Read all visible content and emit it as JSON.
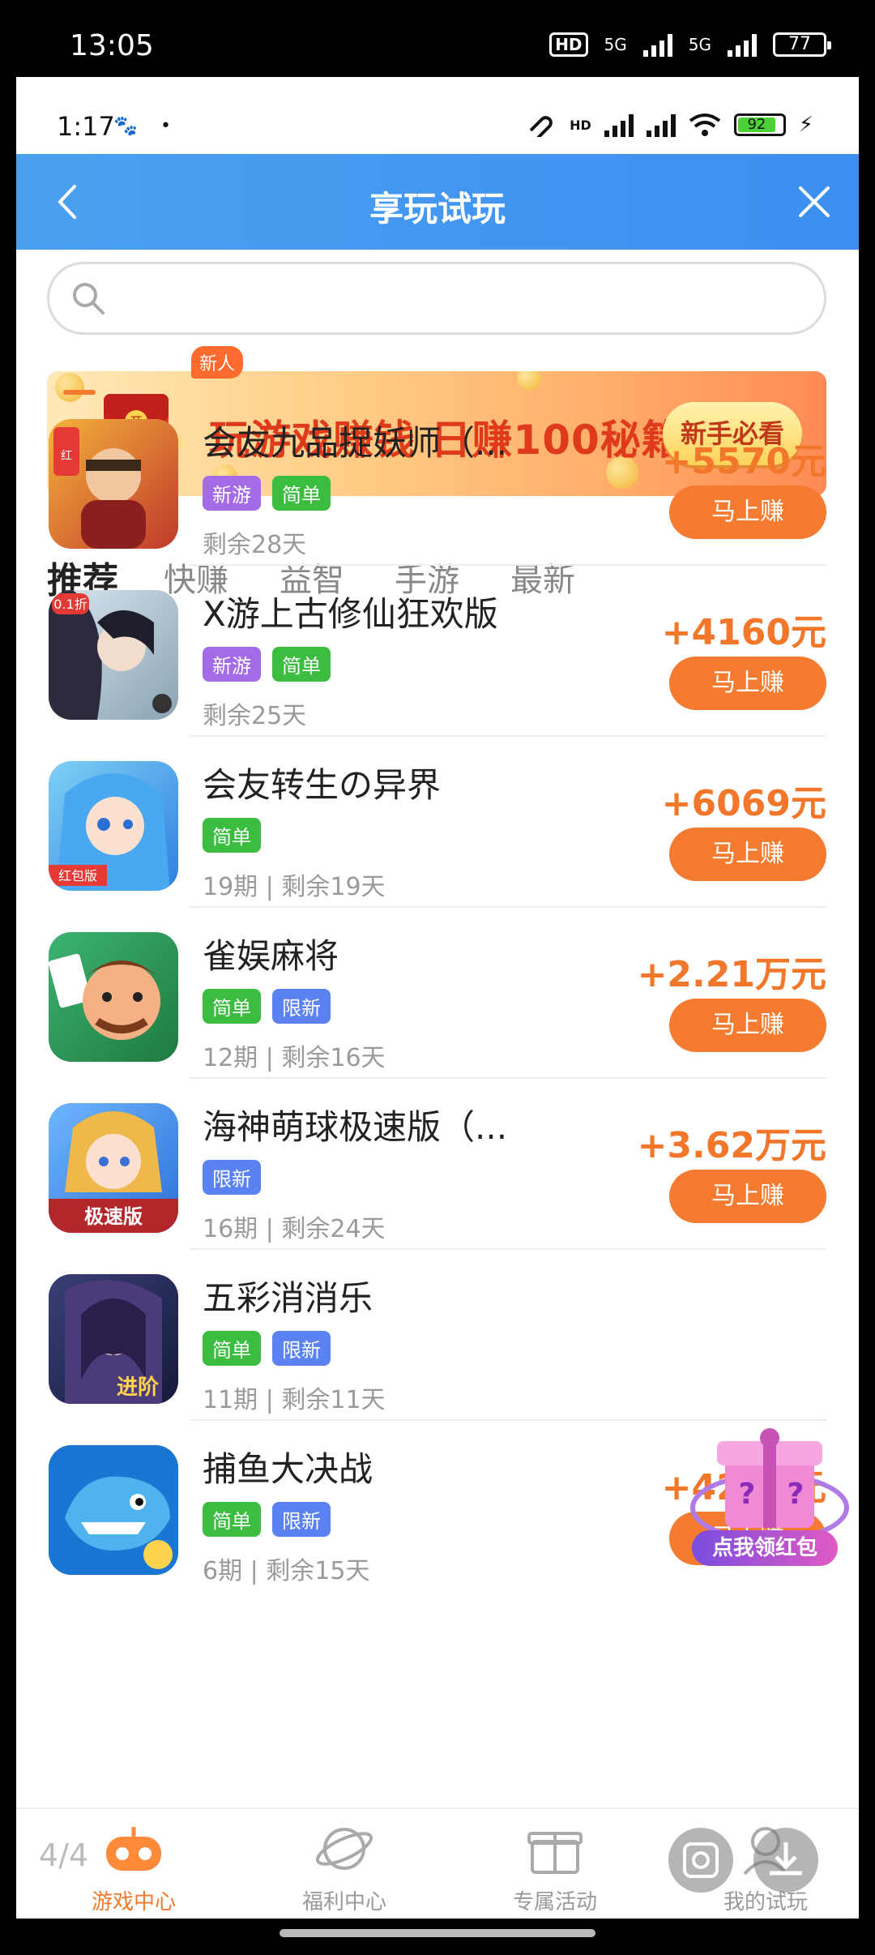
{
  "outer_status": {
    "time": "13:05",
    "hd": "HD",
    "net1": "5G",
    "net2": "5G",
    "battery": "77"
  },
  "inner_status": {
    "time": "1:17",
    "hd": "HD",
    "battery": "92"
  },
  "header": {
    "title": "享玩试玩"
  },
  "search": {
    "placeholder": ""
  },
  "banner": {
    "text": "玩游戏赚钱 日赚100秘籍",
    "cta": "新手必看"
  },
  "tabs": [
    {
      "label": "推荐",
      "active": true
    },
    {
      "label": "快赚",
      "badge": "新人"
    },
    {
      "label": "益智"
    },
    {
      "label": "手游"
    },
    {
      "label": "最新"
    }
  ],
  "games": [
    {
      "name": "会友九品捉妖师（...",
      "tags": [
        "新游",
        "简单"
      ],
      "meta": "剩余28天",
      "reward": "+5570元",
      "button": "马上赚"
    },
    {
      "name": "X游上古修仙狂欢版",
      "tags": [
        "新游",
        "简单"
      ],
      "meta": "剩余25天",
      "reward": "+4160元",
      "button": "马上赚"
    },
    {
      "name": "会友转生の异界",
      "tags": [
        "简单"
      ],
      "meta": "19期 | 剩余19天",
      "reward": "+6069元",
      "button": "马上赚"
    },
    {
      "name": "雀娱麻将",
      "tags": [
        "简单",
        "限新"
      ],
      "meta": "12期 | 剩余16天",
      "reward": "+2.21万元",
      "button": "马上赚"
    },
    {
      "name": "海神萌球极速版（...",
      "tags": [
        "限新"
      ],
      "meta": "16期 | 剩余24天",
      "reward": "+3.62万元",
      "button": "马上赚"
    },
    {
      "name": "五彩消消乐",
      "tags": [
        "简单",
        "限新"
      ],
      "meta": "11期 | 剩余11天",
      "reward": "",
      "button": ""
    },
    {
      "name": "捕鱼大决战",
      "tags": [
        "简单",
        "限新"
      ],
      "meta": "6期 | 剩余15天",
      "reward": "+4268元",
      "button": "马上赚"
    }
  ],
  "float_gift": {
    "label": "点我领红包"
  },
  "bottom_nav": [
    {
      "label": "游戏中心",
      "active": true
    },
    {
      "label": "福利中心"
    },
    {
      "label": "专属活动"
    },
    {
      "label": "我的试玩"
    }
  ],
  "page_indicator": "4/4",
  "colors": {
    "accent": "#f47b2f",
    "header": "#4aa0f0",
    "tag_purple": "#a36be6",
    "tag_green": "#3bbd3f",
    "tag_blue": "#5a82f2"
  }
}
